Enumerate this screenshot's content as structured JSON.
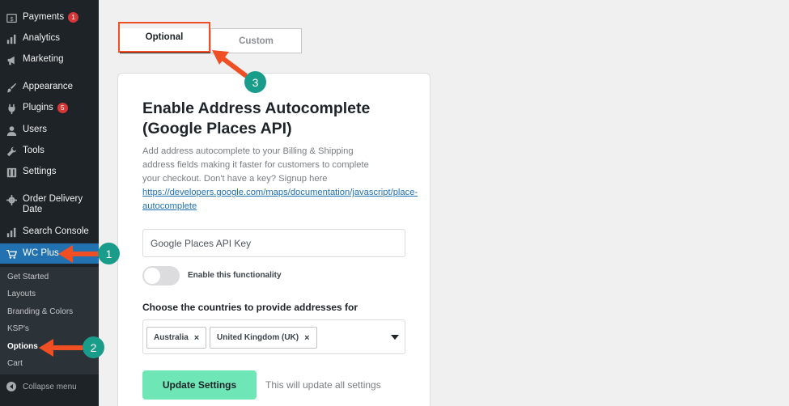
{
  "sidebar": {
    "items": [
      {
        "label": "Payments",
        "badge": "1",
        "icon": "payments-icon"
      },
      {
        "label": "Analytics",
        "icon": "analytics-icon"
      },
      {
        "label": "Marketing",
        "icon": "megaphone-icon"
      },
      {
        "label": "Appearance",
        "icon": "brush-icon"
      },
      {
        "label": "Plugins",
        "badge": "5",
        "icon": "plugin-icon"
      },
      {
        "label": "Users",
        "icon": "users-icon"
      },
      {
        "label": "Tools",
        "icon": "wrench-icon"
      },
      {
        "label": "Settings",
        "icon": "settings-icon"
      },
      {
        "label": "Order Delivery",
        "label2": "Date",
        "icon": "gear-icon"
      },
      {
        "label": "Search Console",
        "icon": "bar-chart-icon"
      },
      {
        "label": "WC Plus",
        "icon": "cart-icon"
      }
    ],
    "submenu": [
      "Get Started",
      "Layouts",
      "Branding & Colors",
      "KSP's",
      "Options",
      "Cart"
    ],
    "collapse_label": "Collapse menu"
  },
  "tabs": {
    "optional": "Optional",
    "custom": "Custom"
  },
  "card": {
    "title_line1": "Enable Address Autocomplete",
    "title_line2": "(Google Places API)",
    "desc_line1": "Add address autocomplete to your Billing & Shipping",
    "desc_line2": "address fields making it faster for customers to complete",
    "desc_line3": "your checkout. Don't have a key? Signup here",
    "link_line1": "https://developers.google.com/maps/documentation/javascript/place-",
    "link_line2": "autocomplete",
    "api_placeholder": "Google Places API Key",
    "toggle_label": "Enable this functionality",
    "countries_label": "Choose the countries to provide addresses for",
    "chips": [
      "Australia",
      "United Kingdom (UK)"
    ],
    "chip_remove": "×",
    "update_button": "Update Settings",
    "update_note": "This will update all settings"
  },
  "annotations": {
    "step1": "1",
    "step2": "2",
    "step3": "3",
    "accent": "#f04e23",
    "badge_color": "#1a9c8a"
  }
}
